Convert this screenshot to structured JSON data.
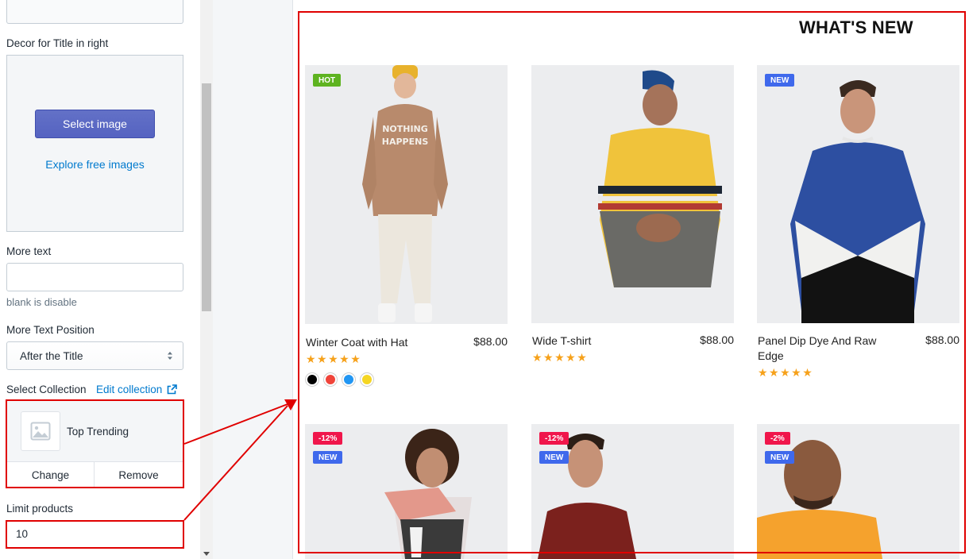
{
  "settings": {
    "decor_label": "Decor for Title in right",
    "select_image_label": "Select image",
    "explore_label": "Explore free images",
    "more_text_label": "More text",
    "more_text_value": "",
    "more_text_help": "blank is disable",
    "position_label": "More Text Position",
    "position_value": "After the Title",
    "collection_label": "Select Collection",
    "edit_collection_label": "Edit collection",
    "collection_name": "Top Trending",
    "change_label": "Change",
    "remove_label": "Remove",
    "limit_label": "Limit products",
    "limit_value": "10"
  },
  "preview": {
    "title": "WHAT'S NEW",
    "products": [
      {
        "name": "Winter Coat with Hat",
        "price": "$88.00",
        "stars": "★★★★★",
        "badges": [
          "HOT"
        ],
        "swatch_colors": [
          "#000000",
          "#f0443a",
          "#2196f3",
          "#f5d623"
        ]
      },
      {
        "name": "Wide T-shirt",
        "price": "$88.00",
        "stars": "★★★★★",
        "badges": []
      },
      {
        "name": "Panel Dip Dye And Raw Edge",
        "price": "$88.00",
        "stars": "★★★★★",
        "badges": [
          "NEW"
        ]
      },
      {
        "badges": [
          "-12%",
          "NEW"
        ]
      },
      {
        "badges": [
          "-12%",
          "NEW"
        ]
      },
      {
        "badges": [
          "-2%",
          "NEW"
        ]
      }
    ]
  },
  "colors": {
    "accent": "#5563c1",
    "link": "#007ace",
    "star": "#f6a11a",
    "annotation": "#e00000"
  }
}
